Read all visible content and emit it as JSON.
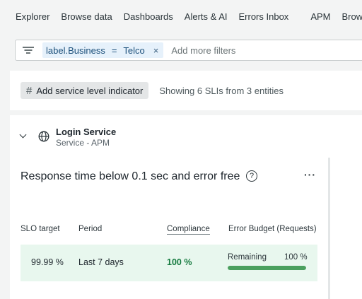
{
  "nav": {
    "items": [
      "Explorer",
      "Browse data",
      "Dashboards",
      "Alerts & AI",
      "Errors Inbox"
    ],
    "items_after_sep": [
      "APM",
      "Browser"
    ]
  },
  "filter": {
    "key": "label.Business",
    "operator": "=",
    "value": "Telco",
    "remove": "×",
    "placeholder": "Add more filters"
  },
  "toolbar": {
    "add_sli_label": "Add service level indicator",
    "hash_glyph": "#",
    "summary": "Showing 6 SLIs from 3 entities"
  },
  "entity": {
    "name": "Login Service",
    "type": "Service - APM"
  },
  "sli": {
    "title": "Response time below 0.1 sec and error free",
    "help": "?",
    "more": "···",
    "columns": {
      "slo_target": "SLO target",
      "period": "Period",
      "compliance": "Compliance",
      "error_budget": "Error Budget (Requests)"
    },
    "row": {
      "slo_target": "99.99 %",
      "period": "Last 7 days",
      "compliance": "100 %",
      "remaining_label": "Remaining",
      "remaining_value": "100 %",
      "remaining_fraction": 1.0
    }
  },
  "colors": {
    "compliance_text": "#157a3f",
    "row_bg": "#e8f7ee",
    "budget_fill": "#4aa05e",
    "pill_bg": "#e6f1fb"
  }
}
